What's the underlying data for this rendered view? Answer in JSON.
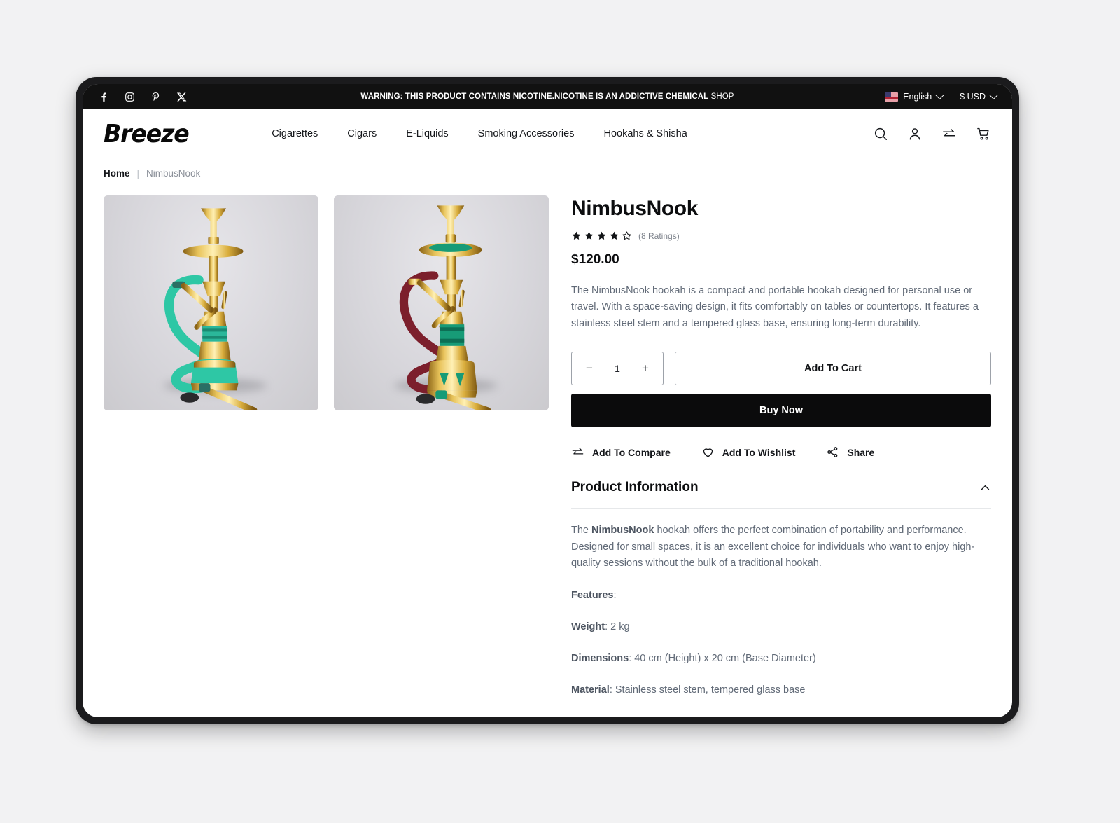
{
  "announcement": {
    "social": [
      {
        "name": "facebook-icon",
        "label": "Facebook"
      },
      {
        "name": "instagram-icon",
        "label": "Instagram"
      },
      {
        "name": "pinterest-icon",
        "label": "Pinterest"
      },
      {
        "name": "x-twitter-icon",
        "label": "X"
      }
    ],
    "warning_bold": "WARNING: THIS PRODUCT CONTAINS NICOTINE.NICOTINE IS AN ADDICTIVE CHEMICAL",
    "warning_light": " SHOP",
    "language": "English",
    "currency": "$ USD"
  },
  "header": {
    "logo": "Breeze",
    "nav": [
      {
        "label": "Cigarettes"
      },
      {
        "label": "Cigars"
      },
      {
        "label": "E-Liquids"
      },
      {
        "label": "Smoking Accessories"
      },
      {
        "label": "Hookahs & Shisha"
      }
    ],
    "actions": [
      "search-icon",
      "account-icon",
      "compare-icon",
      "cart-icon"
    ]
  },
  "breadcrumb": {
    "home": "Home",
    "separator": "|",
    "current": "NimbusNook"
  },
  "gallery": {
    "images": [
      {
        "alt": "NimbusNook hookah with green hose",
        "hose": "#2ec7a5",
        "accent": "#2bb79a"
      },
      {
        "alt": "NimbusNook hookah with maroon hose",
        "hose": "#7c1f2c",
        "accent": "#179b77"
      }
    ]
  },
  "product": {
    "title": "NimbusNook",
    "rating": 4,
    "rating_max": 5,
    "ratings_label": "(8 Ratings)",
    "price": "$120.00",
    "description": "The NimbusNook hookah is a compact and portable hookah designed for personal use or travel. With a space-saving design, it fits comfortably on tables or countertops. It features a stainless steel stem and a tempered glass base, ensuring long-term durability.",
    "quantity": "1",
    "qty_decrease": "−",
    "qty_increase": "+",
    "add_to_cart": "Add To Cart",
    "buy_now": "Buy Now",
    "secondary_actions": [
      {
        "label": "Add To Compare",
        "icon": "compare-icon"
      },
      {
        "label": "Add To Wishlist",
        "icon": "heart-icon"
      },
      {
        "label": "Share",
        "icon": "share-icon"
      }
    ]
  },
  "accordion": {
    "title": "Product Information",
    "state": "expanded",
    "paragraph_pre": "The ",
    "paragraph_bold": "NimbusNook",
    "paragraph_post": " hookah offers the perfect combination of portability and performance. Designed for small spaces, it is an excellent choice for individuals who want to enjoy high-quality sessions without the bulk of a traditional hookah.",
    "specs": [
      {
        "label": "Features",
        "value": ":"
      },
      {
        "label": "Weight",
        "value": ": 2 kg"
      },
      {
        "label": "Dimensions",
        "value": ": 40 cm (Height) x 20 cm (Base Diameter)"
      },
      {
        "label": "Material",
        "value": ": Stainless steel stem, tempered glass base"
      }
    ]
  }
}
